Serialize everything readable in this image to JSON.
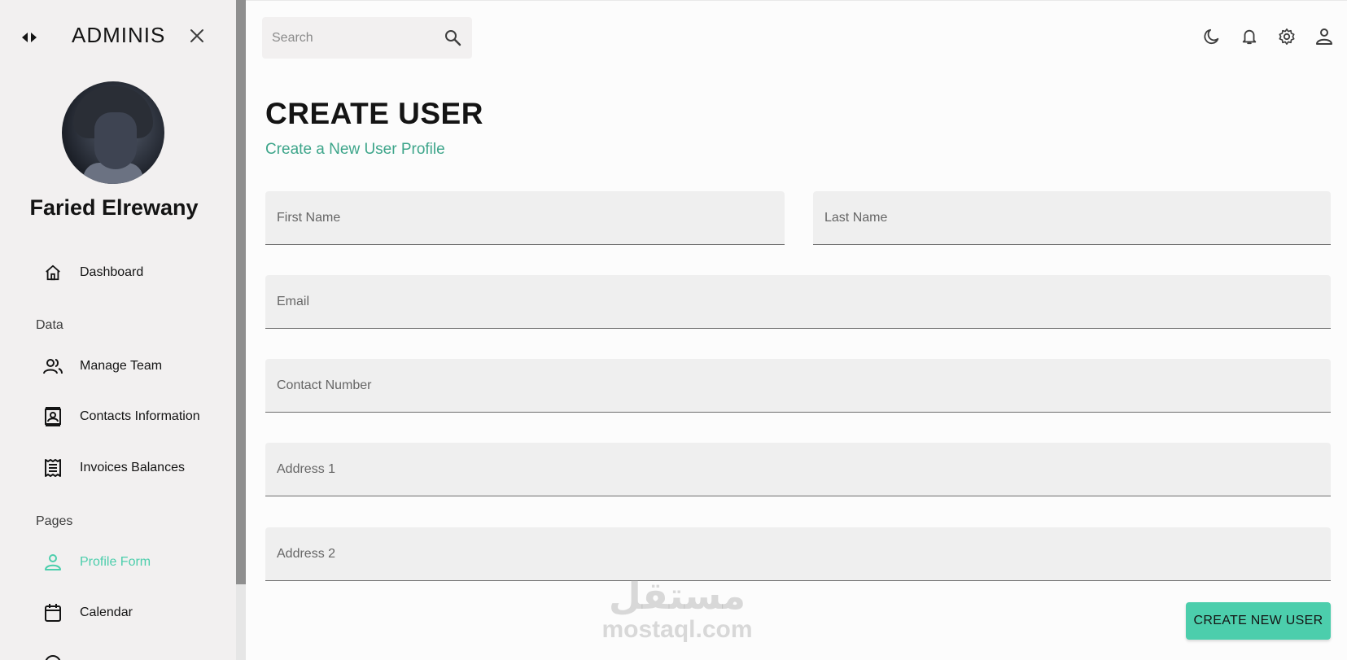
{
  "sidebar": {
    "brand": "ADMINIS",
    "user_name": "Faried Elrewany",
    "items": [
      {
        "label": "Dashboard"
      },
      {
        "label": "Manage Team"
      },
      {
        "label": "Contacts Information"
      },
      {
        "label": "Invoices Balances"
      },
      {
        "label": "Profile Form"
      },
      {
        "label": "Calendar"
      }
    ],
    "sections": [
      "Data",
      "Pages"
    ]
  },
  "topbar": {
    "search_placeholder": "Search"
  },
  "page": {
    "title": "CREATE USER",
    "subtitle": "Create a New User Profile"
  },
  "form": {
    "first_name_placeholder": "First Name",
    "last_name_placeholder": "Last Name",
    "email_placeholder": "Email",
    "contact_placeholder": "Contact Number",
    "address1_placeholder": "Address 1",
    "address2_placeholder": "Address 2",
    "submit_label": "CREATE NEW USER"
  },
  "watermark": {
    "arabic": "مستقل",
    "latin": "mostaql.com"
  },
  "colors": {
    "accent": "#4cceac",
    "subtitle": "#3da58a",
    "sidebar_bg": "#f2f0f0"
  }
}
